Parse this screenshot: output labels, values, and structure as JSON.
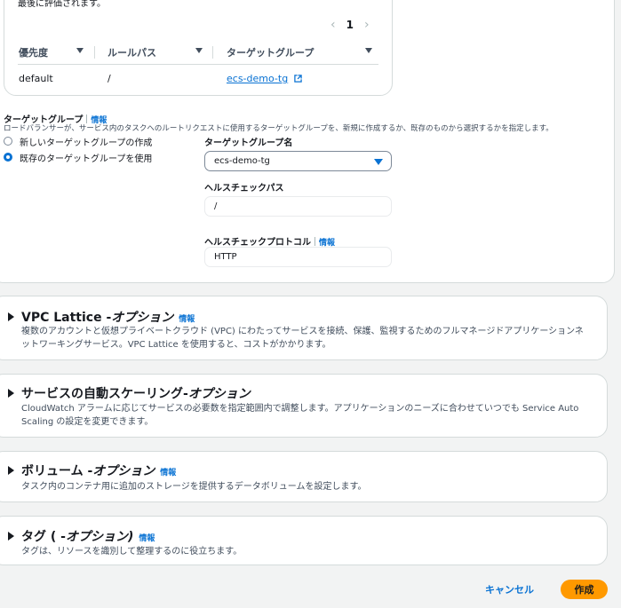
{
  "rule_card": {
    "clipped_text": "最後に評価されます。",
    "pager": {
      "prev": "‹",
      "page": "1",
      "next": "›"
    },
    "columns": [
      "優先度",
      "ルールパス",
      "ターゲットグループ"
    ],
    "row": {
      "priority": "default",
      "path": "/",
      "target_group": "ecs-demo-tg"
    }
  },
  "target_group": {
    "label": "ターゲットグループ",
    "info": "情報",
    "description": "ロードバランサーが、サービス内のタスクへのルートリクエストに使用するターゲットグループを、新規に作成するか、既存のものから選択するかを指定します。",
    "options": [
      "新しいターゲットグループの作成",
      "既存のターゲットグループを使用"
    ],
    "selected_index": 1,
    "name_label": "ターゲットグループ名",
    "name_value": "ecs-demo-tg",
    "health_path_label": "ヘルスチェックパス",
    "health_path_value": "/",
    "health_protocol_label": "ヘルスチェックプロトコル",
    "health_protocol_info": "情報",
    "health_protocol_value": "HTTP"
  },
  "sections": [
    {
      "title": "VPC Lattice - ",
      "title_em": "オプション",
      "info": "情報",
      "description": "複数のアカウントと仮想プライベートクラウド (VPC) にわたってサービスを接続、保護、監視するためのフルマネージドアプリケーションネットワーキングサービス。VPC Lattice を使用すると、コストがかかります。"
    },
    {
      "title": "サービスの自動スケーリング- ",
      "title_em": "オプション",
      "info": "",
      "description": "CloudWatch アラームに応じてサービスの必要数を指定範囲内で調整します。アプリケーションのニーズに合わせていつでも Service Auto Scaling の設定を変更できます。"
    },
    {
      "title": "ボリューム - ",
      "title_em": "オプション",
      "info": "情報",
      "description": "タスク内のコンテナ用に追加のストレージを提供するデータボリュームを設定します。"
    },
    {
      "title": "タグ ( - ",
      "title_em": "オプション)",
      "info": "情報",
      "description": "タグは、リソースを識別して整理するのに役立ちます。"
    }
  ],
  "footer": {
    "cancel": "キャンセル",
    "create": "作成"
  },
  "colors": {
    "link": "#0972d3",
    "primary": "#ff9900"
  }
}
